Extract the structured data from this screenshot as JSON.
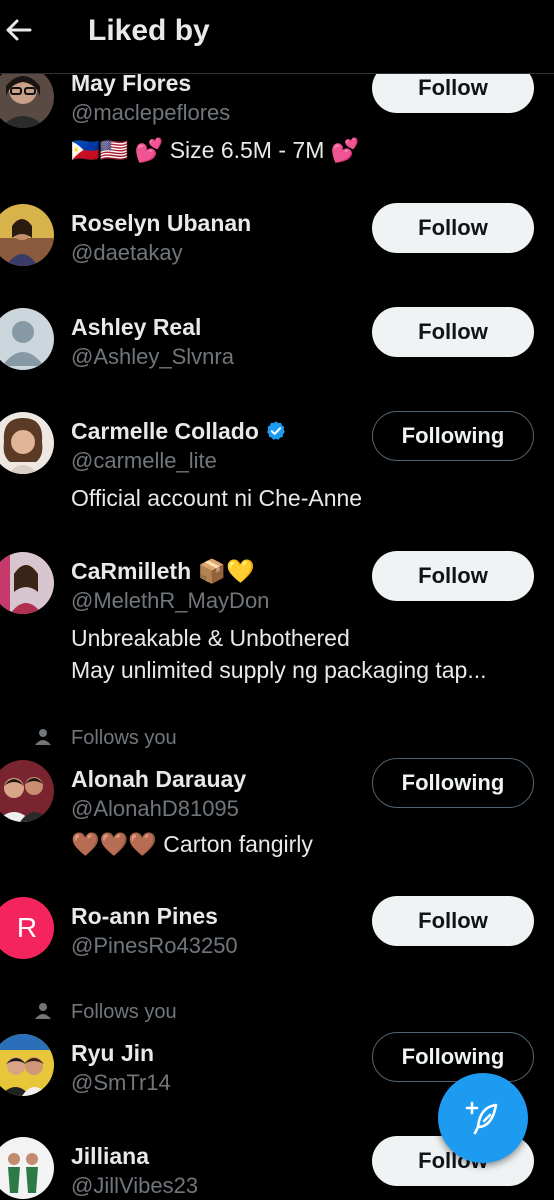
{
  "header": {
    "title": "Liked by"
  },
  "users": [
    {
      "name": "May Flores",
      "handle": "@maclepeflores",
      "bio": "🇵🇭🇺🇸 💕 Size 6.5M - 7M 💕",
      "button": "Follow"
    },
    {
      "name": "Roselyn Ubanan",
      "handle": "@daetakay",
      "button": "Follow"
    },
    {
      "name": "Ashley Real",
      "handle": "@Ashley_Slvnra",
      "button": "Follow"
    },
    {
      "name": "Carmelle Collado",
      "handle": "@carmelle_lite",
      "bio": "Official account ni Che-Anne",
      "button": "Following"
    },
    {
      "name": "CaRmilleth 📦💛",
      "handle": "@MelethR_MayDon",
      "bio_line1": "Unbreakable & Unbothered",
      "bio_line2": "May unlimited supply ng packaging tap...",
      "button": "Follow"
    },
    {
      "context": "Follows you",
      "name": "Alonah Darauay",
      "handle": "@AlonahD81095",
      "bio": "🤎🤎🤎 Carton fangirly",
      "button": "Following"
    },
    {
      "name": "Ro-ann Pines",
      "handle": "@PinesRo43250",
      "avatar_letter": "R",
      "button": "Follow"
    },
    {
      "context": "Follows you",
      "name": "Ryu Jin",
      "handle": "@SmTr14",
      "button": "Following"
    },
    {
      "name": "Jilliana",
      "handle": "@JillVibes23",
      "button": "Follow"
    }
  ],
  "colors": {
    "accent": "#1d9bf0",
    "background": "#000000",
    "secondary_text": "#71767b",
    "avatar_letter_bg": "#f4245e"
  },
  "icons": {
    "back": "arrow-left-icon",
    "verified": "verified-badge-icon",
    "person": "person-icon",
    "compose": "compose-post-icon"
  }
}
